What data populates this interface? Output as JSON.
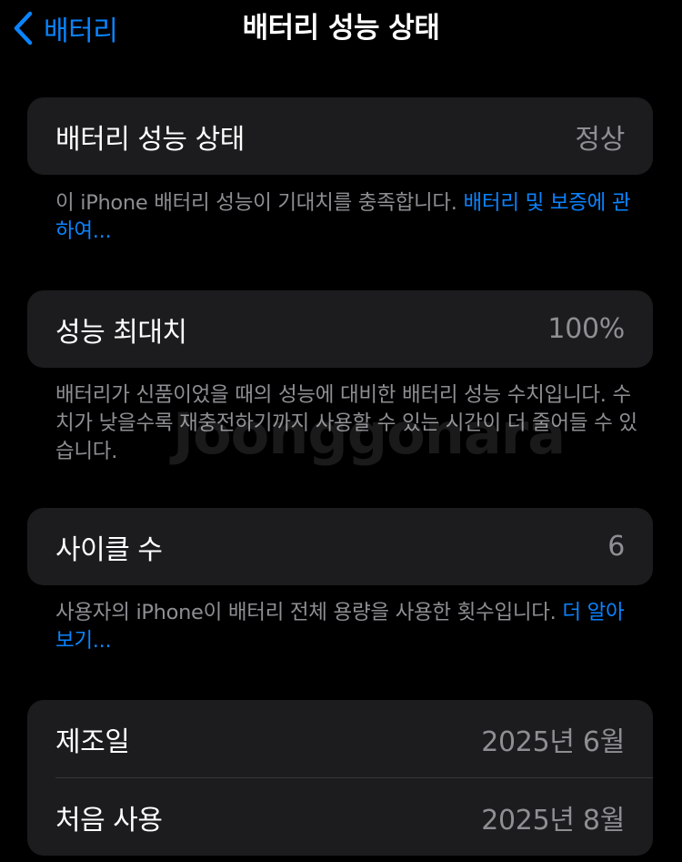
{
  "nav": {
    "back_label": "배터리",
    "title": "배터리 성능 상태"
  },
  "health_group": {
    "label": "배터리 성능 상태",
    "value": "정상"
  },
  "health_footer": {
    "text": "이 iPhone 배터리 성능이 기대치를 충족합니다. ",
    "link": "배터리 및 보증에 관하여..."
  },
  "capacity_group": {
    "label": "성능 최대치",
    "value": "100%"
  },
  "capacity_footer": {
    "text": "배터리가 신품이었을 때의 성능에 대비한 배터리 성능 수치입니다. 수치가 낮을수록 재충전하기까지 사용할 수 있는 시간이 더 줄어들 수 있습니다."
  },
  "cycle_group": {
    "label": "사이클 수",
    "value": "6"
  },
  "cycle_footer": {
    "text": "사용자의 iPhone이 배터리 전체 용량을 사용한 횟수입니다. ",
    "link": "더 알아보기..."
  },
  "dates_group": {
    "rows": [
      {
        "label": "제조일",
        "value": "2025년 6월"
      },
      {
        "label": "처음 사용",
        "value": "2025년 8월"
      }
    ]
  },
  "watermark": "Joonggonara",
  "colors": {
    "accent": "#0a84ff",
    "background": "#000000",
    "cell": "#1c1c1e",
    "secondary_text": "#8e8e93"
  }
}
